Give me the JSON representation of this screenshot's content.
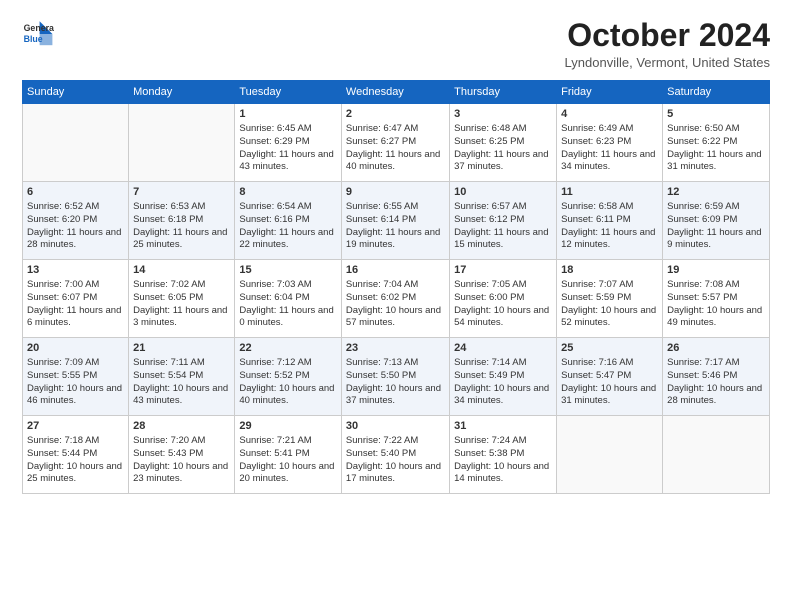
{
  "header": {
    "logo_line1": "General",
    "logo_line2": "Blue",
    "month": "October 2024",
    "location": "Lyndonville, Vermont, United States"
  },
  "days_of_week": [
    "Sunday",
    "Monday",
    "Tuesday",
    "Wednesday",
    "Thursday",
    "Friday",
    "Saturday"
  ],
  "weeks": [
    [
      {
        "day": "",
        "info": ""
      },
      {
        "day": "",
        "info": ""
      },
      {
        "day": "1",
        "info": "Sunrise: 6:45 AM\nSunset: 6:29 PM\nDaylight: 11 hours and 43 minutes."
      },
      {
        "day": "2",
        "info": "Sunrise: 6:47 AM\nSunset: 6:27 PM\nDaylight: 11 hours and 40 minutes."
      },
      {
        "day": "3",
        "info": "Sunrise: 6:48 AM\nSunset: 6:25 PM\nDaylight: 11 hours and 37 minutes."
      },
      {
        "day": "4",
        "info": "Sunrise: 6:49 AM\nSunset: 6:23 PM\nDaylight: 11 hours and 34 minutes."
      },
      {
        "day": "5",
        "info": "Sunrise: 6:50 AM\nSunset: 6:22 PM\nDaylight: 11 hours and 31 minutes."
      }
    ],
    [
      {
        "day": "6",
        "info": "Sunrise: 6:52 AM\nSunset: 6:20 PM\nDaylight: 11 hours and 28 minutes."
      },
      {
        "day": "7",
        "info": "Sunrise: 6:53 AM\nSunset: 6:18 PM\nDaylight: 11 hours and 25 minutes."
      },
      {
        "day": "8",
        "info": "Sunrise: 6:54 AM\nSunset: 6:16 PM\nDaylight: 11 hours and 22 minutes."
      },
      {
        "day": "9",
        "info": "Sunrise: 6:55 AM\nSunset: 6:14 PM\nDaylight: 11 hours and 19 minutes."
      },
      {
        "day": "10",
        "info": "Sunrise: 6:57 AM\nSunset: 6:12 PM\nDaylight: 11 hours and 15 minutes."
      },
      {
        "day": "11",
        "info": "Sunrise: 6:58 AM\nSunset: 6:11 PM\nDaylight: 11 hours and 12 minutes."
      },
      {
        "day": "12",
        "info": "Sunrise: 6:59 AM\nSunset: 6:09 PM\nDaylight: 11 hours and 9 minutes."
      }
    ],
    [
      {
        "day": "13",
        "info": "Sunrise: 7:00 AM\nSunset: 6:07 PM\nDaylight: 11 hours and 6 minutes."
      },
      {
        "day": "14",
        "info": "Sunrise: 7:02 AM\nSunset: 6:05 PM\nDaylight: 11 hours and 3 minutes."
      },
      {
        "day": "15",
        "info": "Sunrise: 7:03 AM\nSunset: 6:04 PM\nDaylight: 11 hours and 0 minutes."
      },
      {
        "day": "16",
        "info": "Sunrise: 7:04 AM\nSunset: 6:02 PM\nDaylight: 10 hours and 57 minutes."
      },
      {
        "day": "17",
        "info": "Sunrise: 7:05 AM\nSunset: 6:00 PM\nDaylight: 10 hours and 54 minutes."
      },
      {
        "day": "18",
        "info": "Sunrise: 7:07 AM\nSunset: 5:59 PM\nDaylight: 10 hours and 52 minutes."
      },
      {
        "day": "19",
        "info": "Sunrise: 7:08 AM\nSunset: 5:57 PM\nDaylight: 10 hours and 49 minutes."
      }
    ],
    [
      {
        "day": "20",
        "info": "Sunrise: 7:09 AM\nSunset: 5:55 PM\nDaylight: 10 hours and 46 minutes."
      },
      {
        "day": "21",
        "info": "Sunrise: 7:11 AM\nSunset: 5:54 PM\nDaylight: 10 hours and 43 minutes."
      },
      {
        "day": "22",
        "info": "Sunrise: 7:12 AM\nSunset: 5:52 PM\nDaylight: 10 hours and 40 minutes."
      },
      {
        "day": "23",
        "info": "Sunrise: 7:13 AM\nSunset: 5:50 PM\nDaylight: 10 hours and 37 minutes."
      },
      {
        "day": "24",
        "info": "Sunrise: 7:14 AM\nSunset: 5:49 PM\nDaylight: 10 hours and 34 minutes."
      },
      {
        "day": "25",
        "info": "Sunrise: 7:16 AM\nSunset: 5:47 PM\nDaylight: 10 hours and 31 minutes."
      },
      {
        "day": "26",
        "info": "Sunrise: 7:17 AM\nSunset: 5:46 PM\nDaylight: 10 hours and 28 minutes."
      }
    ],
    [
      {
        "day": "27",
        "info": "Sunrise: 7:18 AM\nSunset: 5:44 PM\nDaylight: 10 hours and 25 minutes."
      },
      {
        "day": "28",
        "info": "Sunrise: 7:20 AM\nSunset: 5:43 PM\nDaylight: 10 hours and 23 minutes."
      },
      {
        "day": "29",
        "info": "Sunrise: 7:21 AM\nSunset: 5:41 PM\nDaylight: 10 hours and 20 minutes."
      },
      {
        "day": "30",
        "info": "Sunrise: 7:22 AM\nSunset: 5:40 PM\nDaylight: 10 hours and 17 minutes."
      },
      {
        "day": "31",
        "info": "Sunrise: 7:24 AM\nSunset: 5:38 PM\nDaylight: 10 hours and 14 minutes."
      },
      {
        "day": "",
        "info": ""
      },
      {
        "day": "",
        "info": ""
      }
    ]
  ]
}
